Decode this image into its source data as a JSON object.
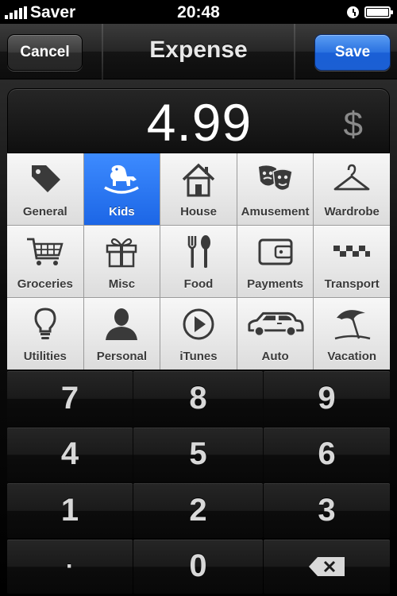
{
  "status_bar": {
    "carrier": "Saver",
    "time": "20:48"
  },
  "nav": {
    "cancel_label": "Cancel",
    "title": "Expense",
    "save_label": "Save"
  },
  "amount": {
    "value": "4.99",
    "currency": "$"
  },
  "categories": [
    {
      "label": "General",
      "icon": "tag-icon",
      "selected": false
    },
    {
      "label": "Kids",
      "icon": "rocking-horse-icon",
      "selected": true
    },
    {
      "label": "House",
      "icon": "house-icon",
      "selected": false
    },
    {
      "label": "Amusement",
      "icon": "theater-masks-icon",
      "selected": false
    },
    {
      "label": "Wardrobe",
      "icon": "hanger-icon",
      "selected": false
    },
    {
      "label": "Groceries",
      "icon": "shopping-cart-icon",
      "selected": false
    },
    {
      "label": "Misc",
      "icon": "gift-icon",
      "selected": false
    },
    {
      "label": "Food",
      "icon": "fork-spoon-icon",
      "selected": false
    },
    {
      "label": "Payments",
      "icon": "wallet-icon",
      "selected": false
    },
    {
      "label": "Transport",
      "icon": "taxi-checker-icon",
      "selected": false
    },
    {
      "label": "Utilities",
      "icon": "lightbulb-icon",
      "selected": false
    },
    {
      "label": "Personal",
      "icon": "person-icon",
      "selected": false
    },
    {
      "label": "iTunes",
      "icon": "play-icon",
      "selected": false
    },
    {
      "label": "Auto",
      "icon": "car-icon",
      "selected": false
    },
    {
      "label": "Vacation",
      "icon": "beach-umbrella-icon",
      "selected": false
    }
  ],
  "keypad": {
    "k7": "7",
    "k8": "8",
    "k9": "9",
    "k4": "4",
    "k5": "5",
    "k6": "6",
    "k1": "1",
    "k2": "2",
    "k3": "3",
    "dot": "·",
    "k0": "0",
    "backspace_icon": "backspace-icon"
  },
  "colors": {
    "selected_category": "#1c66e6",
    "save_button": "#2a72e0",
    "icon_dark": "#3a3a3a"
  }
}
